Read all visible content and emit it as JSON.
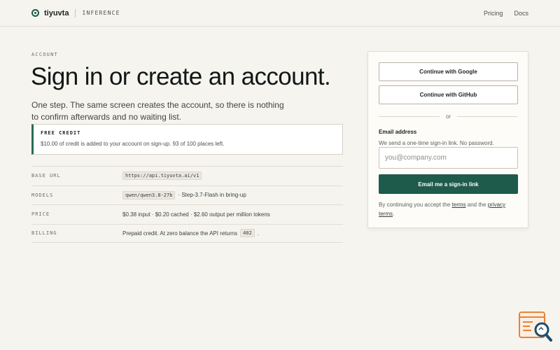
{
  "header": {
    "brand": "tiyuvta",
    "tag": "INFERENCE",
    "nav": [
      {
        "label": "Pricing"
      },
      {
        "label": "Docs"
      }
    ]
  },
  "hero": {
    "eyebrow": "ACCOUNT",
    "title": "Sign in or create an account.",
    "lede": "One step. The same screen creates the account, so there is nothing to confirm afterwards and no waiting list."
  },
  "credit": {
    "title": "FREE CREDIT",
    "text": "$10.00 of credit is added to your account on sign-up. 93 of 100 places left."
  },
  "spec": {
    "base_url": {
      "key": "BASE URL",
      "value": "https://api.tiyuvta.ai/v1"
    },
    "models": {
      "key": "MODELS",
      "chip": "qwen/qwen3.8-27b",
      "rest": "· Step-3.7-Flash in bring-up"
    },
    "price": {
      "key": "PRICE",
      "value": "$0.38 input · $0.20 cached · $2.60 output per million tokens"
    },
    "billing": {
      "key": "BILLING",
      "value": "Prepaid credit. At zero balance the API returns",
      "chip": "402",
      "suffix": "."
    }
  },
  "card": {
    "google_label": "Continue with Google",
    "github_label": "Continue with GitHub",
    "or_label": "or",
    "email_label": "Email address",
    "email_help": "We send a one-time sign-in link. No password.",
    "email_placeholder": "you@company.com",
    "submit_label": "Email me a sign-in link",
    "legal_prefix": "By continuing you accept the",
    "terms_link": "terms",
    "legal_mid": "and the",
    "privacy_link": "privacy terms",
    "legal_suffix": "."
  },
  "colors": {
    "accent": "#1e5b4a",
    "background": "#f6f4ef",
    "widget_orange": "#e8833a",
    "widget_blue": "#1f4e6b"
  }
}
